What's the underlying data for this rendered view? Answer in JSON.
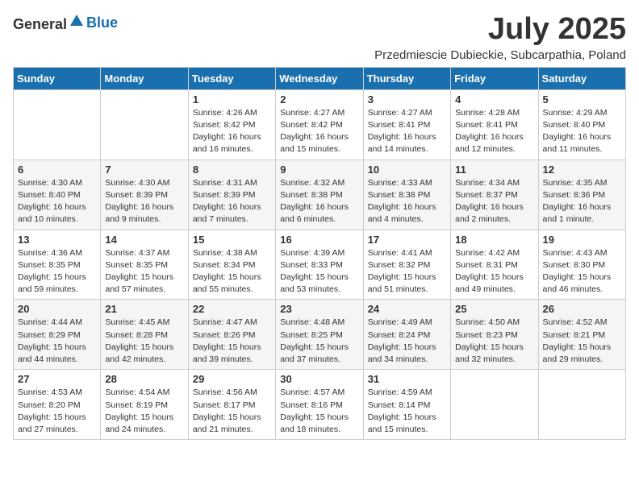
{
  "logo": {
    "general": "General",
    "blue": "Blue"
  },
  "title": "July 2025",
  "subtitle": "Przedmiescie Dubieckie, Subcarpathia, Poland",
  "weekdays": [
    "Sunday",
    "Monday",
    "Tuesday",
    "Wednesday",
    "Thursday",
    "Friday",
    "Saturday"
  ],
  "weeks": [
    [
      {
        "day": "",
        "info": ""
      },
      {
        "day": "",
        "info": ""
      },
      {
        "day": "1",
        "info": "Sunrise: 4:26 AM\nSunset: 8:42 PM\nDaylight: 16 hours and 16 minutes."
      },
      {
        "day": "2",
        "info": "Sunrise: 4:27 AM\nSunset: 8:42 PM\nDaylight: 16 hours and 15 minutes."
      },
      {
        "day": "3",
        "info": "Sunrise: 4:27 AM\nSunset: 8:41 PM\nDaylight: 16 hours and 14 minutes."
      },
      {
        "day": "4",
        "info": "Sunrise: 4:28 AM\nSunset: 8:41 PM\nDaylight: 16 hours and 12 minutes."
      },
      {
        "day": "5",
        "info": "Sunrise: 4:29 AM\nSunset: 8:40 PM\nDaylight: 16 hours and 11 minutes."
      }
    ],
    [
      {
        "day": "6",
        "info": "Sunrise: 4:30 AM\nSunset: 8:40 PM\nDaylight: 16 hours and 10 minutes."
      },
      {
        "day": "7",
        "info": "Sunrise: 4:30 AM\nSunset: 8:39 PM\nDaylight: 16 hours and 9 minutes."
      },
      {
        "day": "8",
        "info": "Sunrise: 4:31 AM\nSunset: 8:39 PM\nDaylight: 16 hours and 7 minutes."
      },
      {
        "day": "9",
        "info": "Sunrise: 4:32 AM\nSunset: 8:38 PM\nDaylight: 16 hours and 6 minutes."
      },
      {
        "day": "10",
        "info": "Sunrise: 4:33 AM\nSunset: 8:38 PM\nDaylight: 16 hours and 4 minutes."
      },
      {
        "day": "11",
        "info": "Sunrise: 4:34 AM\nSunset: 8:37 PM\nDaylight: 16 hours and 2 minutes."
      },
      {
        "day": "12",
        "info": "Sunrise: 4:35 AM\nSunset: 8:36 PM\nDaylight: 16 hours and 1 minute."
      }
    ],
    [
      {
        "day": "13",
        "info": "Sunrise: 4:36 AM\nSunset: 8:35 PM\nDaylight: 15 hours and 59 minutes."
      },
      {
        "day": "14",
        "info": "Sunrise: 4:37 AM\nSunset: 8:35 PM\nDaylight: 15 hours and 57 minutes."
      },
      {
        "day": "15",
        "info": "Sunrise: 4:38 AM\nSunset: 8:34 PM\nDaylight: 15 hours and 55 minutes."
      },
      {
        "day": "16",
        "info": "Sunrise: 4:39 AM\nSunset: 8:33 PM\nDaylight: 15 hours and 53 minutes."
      },
      {
        "day": "17",
        "info": "Sunrise: 4:41 AM\nSunset: 8:32 PM\nDaylight: 15 hours and 51 minutes."
      },
      {
        "day": "18",
        "info": "Sunrise: 4:42 AM\nSunset: 8:31 PM\nDaylight: 15 hours and 49 minutes."
      },
      {
        "day": "19",
        "info": "Sunrise: 4:43 AM\nSunset: 8:30 PM\nDaylight: 15 hours and 46 minutes."
      }
    ],
    [
      {
        "day": "20",
        "info": "Sunrise: 4:44 AM\nSunset: 8:29 PM\nDaylight: 15 hours and 44 minutes."
      },
      {
        "day": "21",
        "info": "Sunrise: 4:45 AM\nSunset: 8:28 PM\nDaylight: 15 hours and 42 minutes."
      },
      {
        "day": "22",
        "info": "Sunrise: 4:47 AM\nSunset: 8:26 PM\nDaylight: 15 hours and 39 minutes."
      },
      {
        "day": "23",
        "info": "Sunrise: 4:48 AM\nSunset: 8:25 PM\nDaylight: 15 hours and 37 minutes."
      },
      {
        "day": "24",
        "info": "Sunrise: 4:49 AM\nSunset: 8:24 PM\nDaylight: 15 hours and 34 minutes."
      },
      {
        "day": "25",
        "info": "Sunrise: 4:50 AM\nSunset: 8:23 PM\nDaylight: 15 hours and 32 minutes."
      },
      {
        "day": "26",
        "info": "Sunrise: 4:52 AM\nSunset: 8:21 PM\nDaylight: 15 hours and 29 minutes."
      }
    ],
    [
      {
        "day": "27",
        "info": "Sunrise: 4:53 AM\nSunset: 8:20 PM\nDaylight: 15 hours and 27 minutes."
      },
      {
        "day": "28",
        "info": "Sunrise: 4:54 AM\nSunset: 8:19 PM\nDaylight: 15 hours and 24 minutes."
      },
      {
        "day": "29",
        "info": "Sunrise: 4:56 AM\nSunset: 8:17 PM\nDaylight: 15 hours and 21 minutes."
      },
      {
        "day": "30",
        "info": "Sunrise: 4:57 AM\nSunset: 8:16 PM\nDaylight: 15 hours and 18 minutes."
      },
      {
        "day": "31",
        "info": "Sunrise: 4:59 AM\nSunset: 8:14 PM\nDaylight: 15 hours and 15 minutes."
      },
      {
        "day": "",
        "info": ""
      },
      {
        "day": "",
        "info": ""
      }
    ]
  ]
}
